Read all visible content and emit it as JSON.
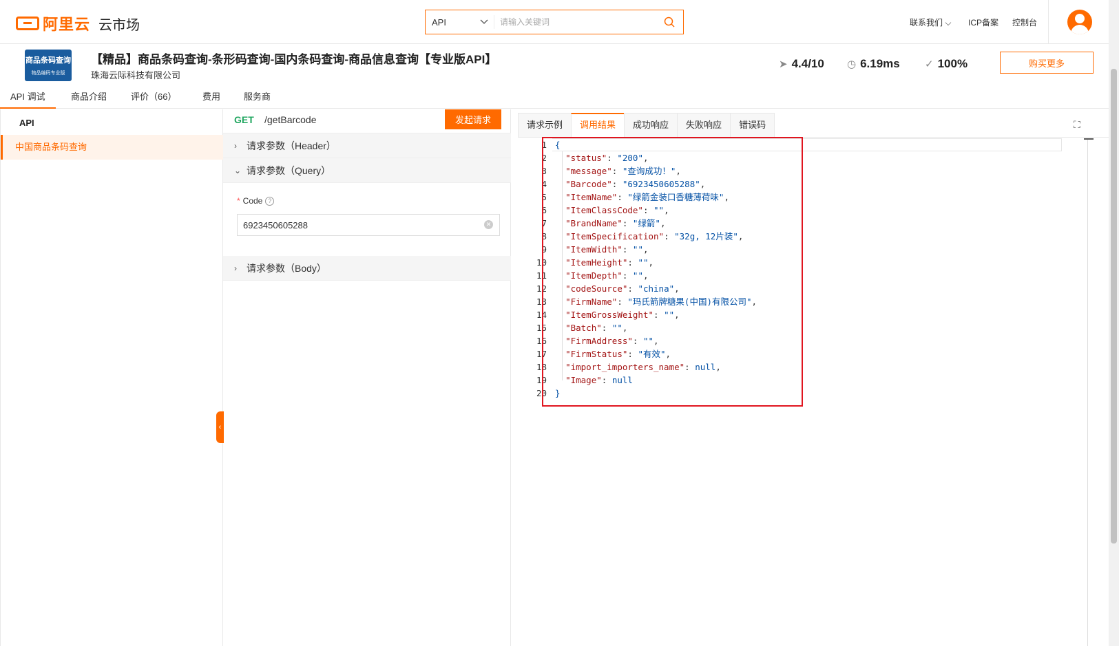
{
  "header": {
    "logo_text": "阿里云",
    "market_label": "云市场",
    "search": {
      "type_value": "API",
      "placeholder": "请输入关键词"
    },
    "links": [
      "联系我们",
      "ICP备案",
      "控制台"
    ],
    "accent_color": "#ff6a00"
  },
  "product": {
    "logo_line1": "商品条码查询",
    "logo_line2": "物品编码专业版",
    "title": "【精品】商品条码查询-条形码查询-国内条码查询-商品信息查询【专业版API】",
    "vendor": "珠海云际科技有限公司",
    "rating": "4.4/10",
    "latency": "6.19ms",
    "success_rate": "100%",
    "buy_label": "购买更多"
  },
  "nav_tabs": [
    "API 调试",
    "商品介绍",
    "评价（66）",
    "费用",
    "服务商"
  ],
  "sidebar": {
    "heading": "API",
    "items": [
      "中国商品条码查询"
    ]
  },
  "request": {
    "method": "GET",
    "path": "/getBarcode",
    "send_label": "发起请求",
    "sections": {
      "header": "请求参数（Header）",
      "query": "请求参数（Query）",
      "body": "请求参数（Body）"
    },
    "code_label": "Code",
    "code_value": "6923450605288"
  },
  "result_tabs": [
    "请求示例",
    "调用结果",
    "成功响应",
    "失败响应",
    "错误码"
  ],
  "response_lines": [
    {
      "key": null,
      "value": null,
      "text": "{"
    },
    {
      "key": "status",
      "value": "\"200\"",
      "type": "s"
    },
    {
      "key": "message",
      "value": "\"查询成功！\"",
      "type": "s"
    },
    {
      "key": "Barcode",
      "value": "\"6923450605288\"",
      "type": "s"
    },
    {
      "key": "ItemName",
      "value": "\"绿箭金装口香糖薄荷味\"",
      "type": "s"
    },
    {
      "key": "ItemClassCode",
      "value": "\"\"",
      "type": "s"
    },
    {
      "key": "BrandName",
      "value": "\"绿箭\"",
      "type": "s"
    },
    {
      "key": "ItemSpecification",
      "value": "\"32g, 12片装\"",
      "type": "s"
    },
    {
      "key": "ItemWidth",
      "value": "\"\"",
      "type": "s"
    },
    {
      "key": "ItemHeight",
      "value": "\"\"",
      "type": "s"
    },
    {
      "key": "ItemDepth",
      "value": "\"\"",
      "type": "s"
    },
    {
      "key": "codeSource",
      "value": "\"china\"",
      "type": "s"
    },
    {
      "key": "FirmName",
      "value": "\"玛氏箭牌糖果(中国)有限公司\"",
      "type": "s"
    },
    {
      "key": "ItemGrossWeight",
      "value": "\"\"",
      "type": "s"
    },
    {
      "key": "Batch",
      "value": "\"\"",
      "type": "s"
    },
    {
      "key": "FirmAddress",
      "value": "\"\"",
      "type": "s"
    },
    {
      "key": "FirmStatus",
      "value": "\"有效\"",
      "type": "s"
    },
    {
      "key": "import_importers_name",
      "value": "null",
      "type": "n"
    },
    {
      "key": "Image",
      "value": "null",
      "type": "n",
      "last": true
    },
    {
      "key": null,
      "value": null,
      "text": "}"
    }
  ]
}
